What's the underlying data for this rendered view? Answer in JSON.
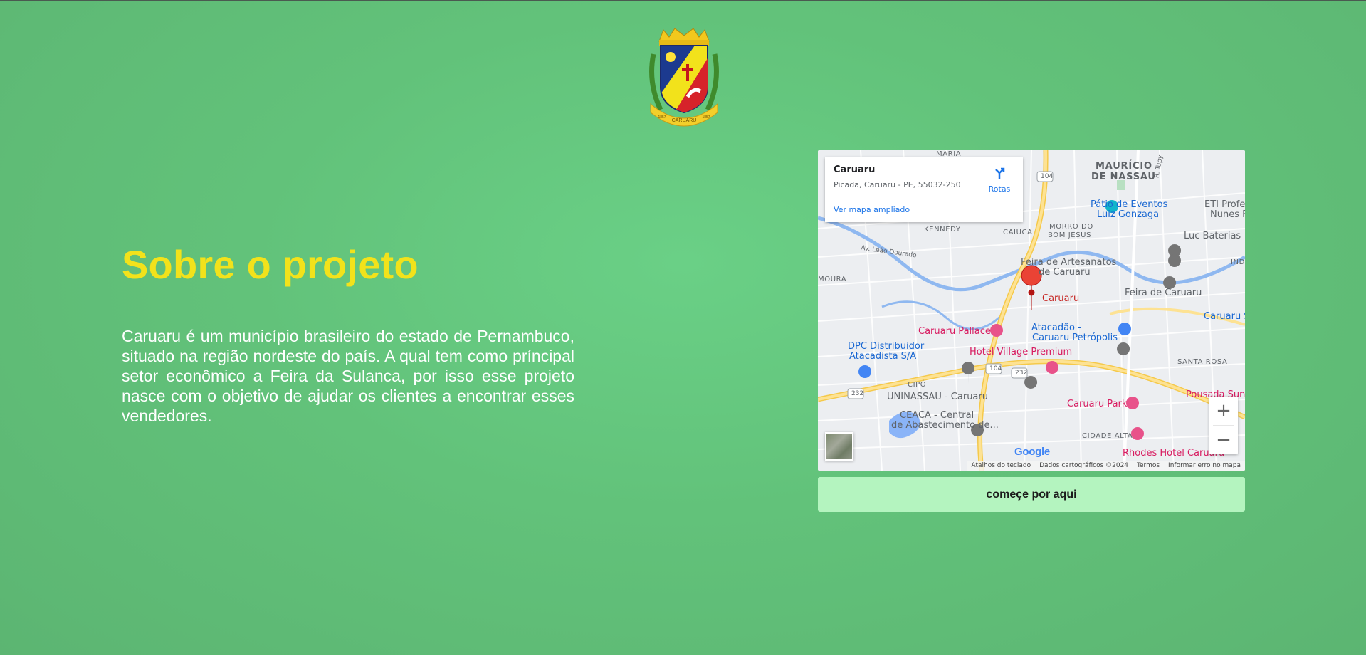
{
  "header": {
    "crest_name": "CARUARU",
    "crest_year_left": "1857",
    "crest_year_right": "1857"
  },
  "about": {
    "title": "Sobre o projeto",
    "text": "Caruaru é um município brasileiro do estado de Pernambuco, situado na região nordeste do país. A qual tem como príncipal setor econômico a Feira da Sulanca, por isso esse projeto nasce com o objetivo de ajudar os clientes a encontrar esses vendedores."
  },
  "map": {
    "place_title": "Caruaru",
    "place_address": "Picada, Caruaru - PE, 55032-250",
    "route_label": "Rotas",
    "larger_map_link": "Ver mapa ampliado",
    "marker_label": "Caruaru",
    "labels": {
      "maria": "MARIA",
      "mauricio": "MAURÍCIO",
      "de_nassau": "DE NASSAU",
      "patio": "Pátio de Eventos",
      "luiz": "Luiz Gonzaga",
      "eti": "ETI Profe",
      "nunes": "Nunes F",
      "kennedy": "KENNEDY",
      "caiuca": "CAIUCA",
      "morro": "MORRO DO",
      "bom_jesus": "BOM JESUS",
      "luc": "Luc Baterias",
      "leao": "Av. Leão Dourado",
      "feira_art": "Feira de Artesanatos",
      "de_caruaru": "de Caruaru",
      "moura": "MOURA",
      "feira": "Feira de Caruaru",
      "ind": "IND",
      "caruaru_s": "Caruaru S",
      "pallace": "Caruaru Pallace",
      "atacadao": "Atacadão -",
      "petropolis": "Caruaru Petrópolis",
      "dpc": "DPC Distribuidor",
      "atacadista": "Atacadista S/A",
      "village": "Hotel Village Premium",
      "santa_rosa": "SANTA ROSA",
      "cipo": "CIPÓ",
      "uninassau": "UNINASSAU - Caruaru",
      "park": "Caruaru Park",
      "pousada": "Pousada Sun",
      "ceaca": "CEACA - Central",
      "abastecimento": "de Abastecimento de...",
      "cidade_alta": "CIDADE ALTA",
      "rhodes": "Rhodes Hotel Caruaru",
      "r_tupy": "R. Tupy",
      "road_104a": "104",
      "road_104b": "104",
      "road_232a": "232",
      "road_232b": "232"
    },
    "google_logo": "Google",
    "attribution": {
      "shortcuts": "Atalhos do teclado",
      "data": "Dados cartográficos ©2024",
      "terms": "Termos",
      "report": "Informar erro no mapa"
    },
    "zoom_in": "+",
    "zoom_out": "−"
  },
  "cta": {
    "label": "começe por aqui"
  },
  "colors": {
    "background": "#64c47d",
    "title": "#f2e21b",
    "button": "#b4f4bf",
    "link": "#1a73e8"
  }
}
